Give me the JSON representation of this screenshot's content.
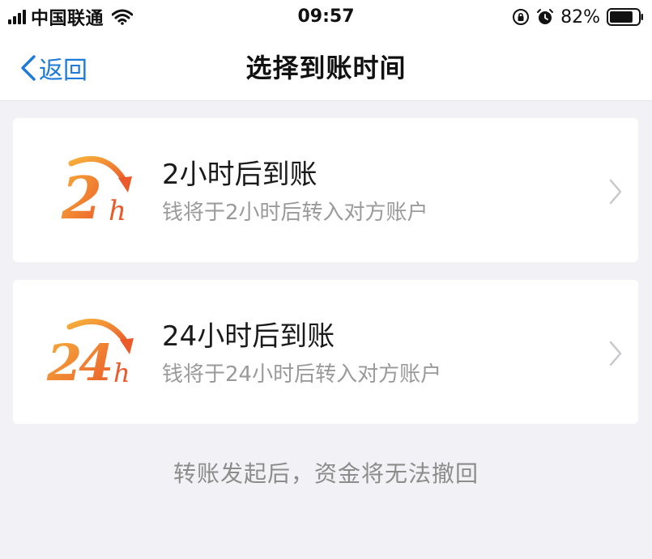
{
  "status_bar": {
    "carrier": "中国联通",
    "time": "09:57",
    "battery_percent": "82%",
    "battery_level": 0.82
  },
  "nav": {
    "back_label": "返回",
    "title": "选择到账时间",
    "accent_color": "#1e7ad9"
  },
  "options": [
    {
      "logo_number": "2",
      "logo_unit": "h",
      "title": "2小时后到账",
      "description": "钱将于2小时后转入对方账户"
    },
    {
      "logo_number": "24",
      "logo_unit": "h",
      "title": "24小时后到账",
      "description": "钱将于24小时后转入对方账户"
    }
  ],
  "logo_colors": {
    "start": "#f7b13c",
    "end": "#ea5a2a"
  },
  "notice": "转账发起后，资金将无法撤回"
}
